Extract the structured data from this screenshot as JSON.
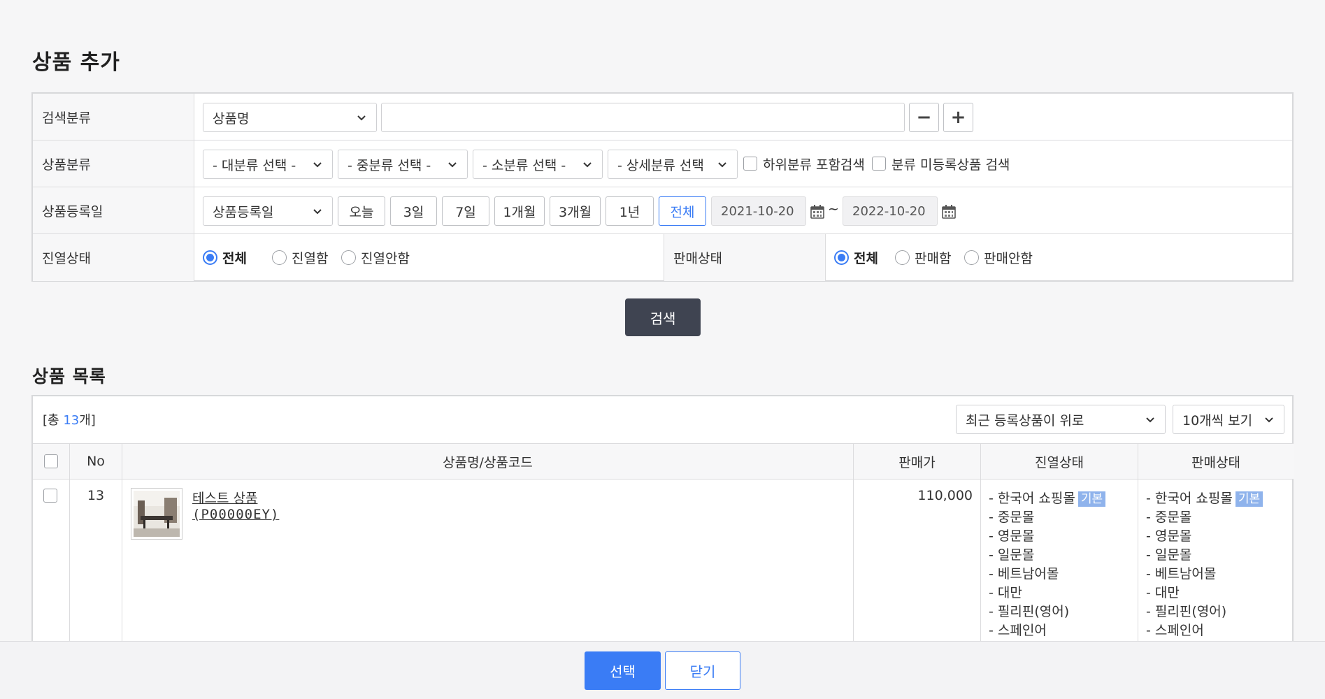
{
  "page": {
    "title": "상품 추가",
    "list_title": "상품 목록"
  },
  "search": {
    "labels": {
      "category_search": "검색분류",
      "product_category": "상품분류",
      "reg_date": "상품등록일",
      "display_status": "진열상태",
      "sale_status": "판매상태"
    },
    "search_type": "상품명",
    "keyword": "",
    "minus": "−",
    "plus": "+",
    "category_selects": [
      "- 대분류 선택 -",
      "- 중분류 선택 -",
      "- 소분류 선택 -",
      "- 상세분류 선택"
    ],
    "include_sub": "하위분류 포함검색",
    "unregistered": "분류 미등록상품 검색",
    "date_type": "상품등록일",
    "periods": [
      "오늘",
      "3일",
      "7일",
      "1개월",
      "3개월",
      "1년",
      "전체"
    ],
    "active_period": "전체",
    "date_from": "2021-10-20",
    "date_to": "2022-10-20",
    "tilde": "~",
    "display_options": [
      "전체",
      "진열함",
      "진열안함"
    ],
    "display_selected": "전체",
    "sale_options": [
      "전체",
      "판매함",
      "판매안함"
    ],
    "sale_selected": "전체",
    "button": "검색"
  },
  "list": {
    "count_prefix": "[총 ",
    "count": "13",
    "count_suffix": "개]",
    "sort": "최근 등록상품이 위로",
    "per_page": "10개씩 보기",
    "columns": [
      "No",
      "상품명/상품코드",
      "판매가",
      "진열상태",
      "판매상태"
    ],
    "rows": [
      {
        "no": "13",
        "name": "테스트 상품",
        "code": "(P00000EY)",
        "price": "110,000",
        "malls": [
          "- 한국어 쇼핑몰",
          "- 중문몰",
          "- 영문몰",
          "- 일문몰",
          "- 베트남어몰",
          "- 대만",
          "- 필리핀(영어)",
          "- 스페인어"
        ],
        "default_badge": "기본"
      }
    ]
  },
  "footer": {
    "select": "선택",
    "close": "닫기"
  },
  "colors": {
    "accent": "#3a7cf5",
    "dark_button": "#3f4451",
    "badge": "#8fb3ec"
  }
}
